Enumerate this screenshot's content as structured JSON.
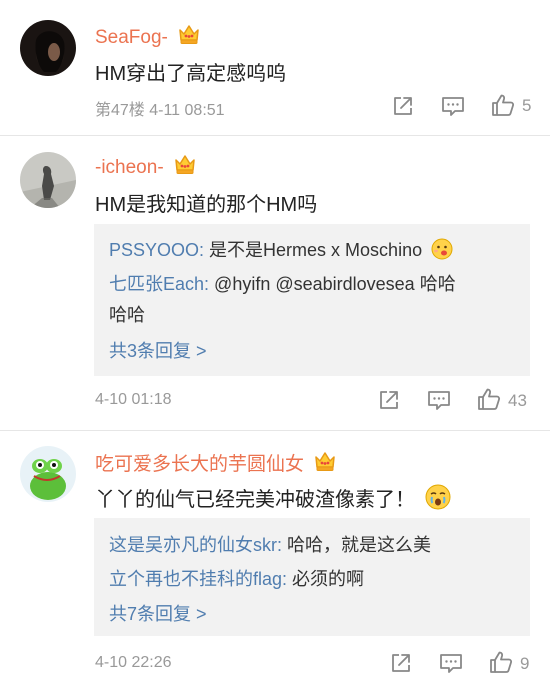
{
  "comments": [
    {
      "username": "SeaFog-",
      "text": "HM穿出了高定感呜呜",
      "meta": "第47楼 4-11 08:51",
      "likes": "5"
    },
    {
      "username": "-icheon-",
      "text": "HM是我知道的那个HM吗",
      "meta": "4-10 01:18",
      "likes": "43",
      "replies": [
        {
          "user": "PSSYOOO",
          "sep": ": ",
          "text": "是不是Hermes x Moschino"
        },
        {
          "user": "七匹张Each",
          "sep": ": ",
          "text": "@hyifn @seabirdlovesea 哈哈",
          "cont": "哈哈"
        }
      ],
      "more": "共3条回复 >"
    },
    {
      "username": "吃可爱多长大的芋圆仙女",
      "text": "丫丫的仙气已经完美冲破渣像素了！",
      "meta": "4-10 22:26",
      "likes": "9",
      "replies": [
        {
          "user": "这是吴亦凡的仙女skr",
          "sep": ": ",
          "text": "哈哈，就是这么美"
        },
        {
          "user": "立个再也不挂科的flag",
          "sep": ": ",
          "text": "必须的啊"
        }
      ],
      "more": "共7条回复 >"
    }
  ],
  "colors": {
    "username": "#eb7350",
    "link": "#507daf",
    "meta": "#999999",
    "reply_bg": "#f2f2f2"
  },
  "icons": [
    "crown-icon",
    "share-icon",
    "comment-icon",
    "like-icon",
    "smiley-emoji",
    "tearful-emoji"
  ]
}
